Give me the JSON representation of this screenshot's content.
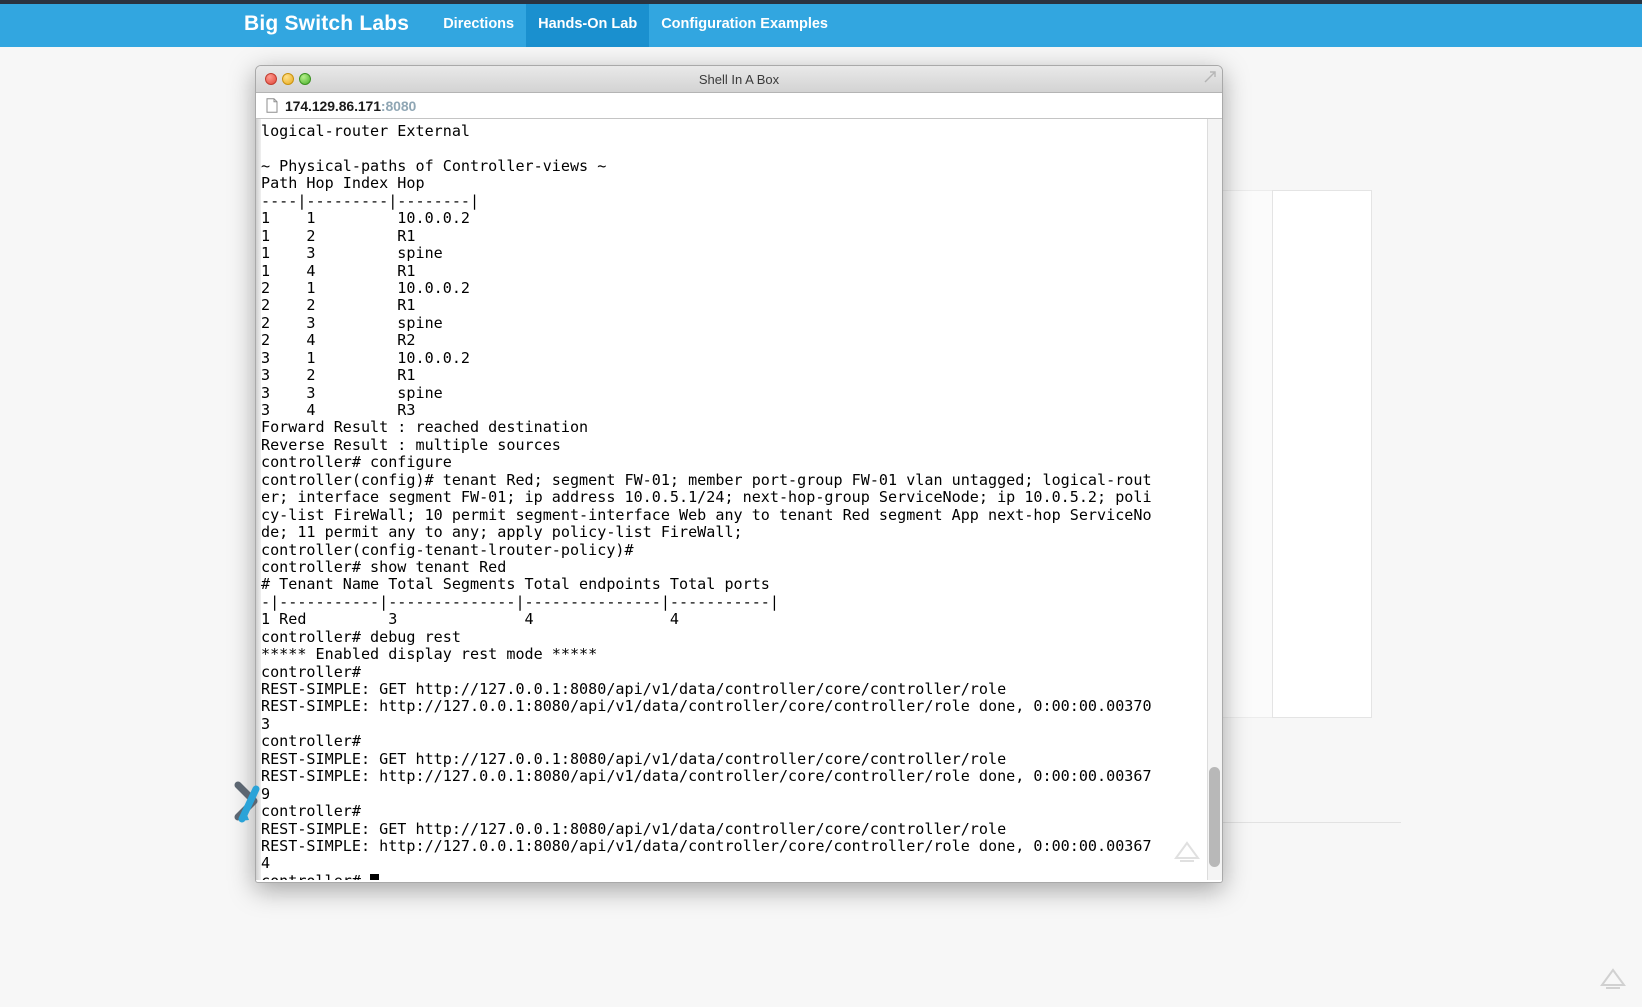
{
  "topnav": {
    "brand": "Big Switch Labs",
    "items": [
      {
        "label": "Directions",
        "active": false
      },
      {
        "label": "Hands-On Lab",
        "active": true
      },
      {
        "label": "Configuration Examples",
        "active": false
      }
    ],
    "background_color": "#32a6e0",
    "active_color": "#1a90cf"
  },
  "window": {
    "title": "Shell In A Box",
    "url_host": "174.129.86.171",
    "url_port": ":8080",
    "traffic_lights": [
      "close-red",
      "minimize-yellow",
      "zoom-green"
    ]
  },
  "terminal": {
    "lines": [
      "logical-router External",
      "",
      "~ Physical-paths of Controller-views ~",
      "Path Hop Index Hop",
      "----|---------|--------|",
      "1    1         10.0.0.2",
      "1    2         R1",
      "1    3         spine",
      "1    4         R1",
      "2    1         10.0.0.2",
      "2    2         R1",
      "2    3         spine",
      "2    4         R2",
      "3    1         10.0.0.2",
      "3    2         R1",
      "3    3         spine",
      "3    4         R3",
      "Forward Result : reached destination",
      "Reverse Result : multiple sources",
      "controller# configure",
      "controller(config)# tenant Red; segment FW-01; member port-group FW-01 vlan untagged; logical-rout",
      "er; interface segment FW-01; ip address 10.0.5.1/24; next-hop-group ServiceNode; ip 10.0.5.2; poli",
      "cy-list FireWall; 10 permit segment-interface Web any to tenant Red segment App next-hop ServiceNo",
      "de; 11 permit any to any; apply policy-list FireWall;",
      "controller(config-tenant-lrouter-policy)#",
      "controller# show tenant Red",
      "# Tenant Name Total Segments Total endpoints Total ports",
      "-|-----------|--------------|---------------|-----------|",
      "1 Red         3              4               4",
      "controller# debug rest",
      "***** Enabled display rest mode *****",
      "controller#",
      "REST-SIMPLE: GET http://127.0.0.1:8080/api/v1/data/controller/core/controller/role",
      "REST-SIMPLE: http://127.0.0.1:8080/api/v1/data/controller/core/controller/role done, 0:00:00.00370",
      "3",
      "controller#",
      "REST-SIMPLE: GET http://127.0.0.1:8080/api/v1/data/controller/core/controller/role",
      "REST-SIMPLE: http://127.0.0.1:8080/api/v1/data/controller/core/controller/role done, 0:00:00.00367",
      "9",
      "controller#",
      "REST-SIMPLE: GET http://127.0.0.1:8080/api/v1/data/controller/core/controller/role",
      "REST-SIMPLE: http://127.0.0.1:8080/api/v1/data/controller/core/controller/role done, 0:00:00.00367",
      "4"
    ],
    "prompt": "controller# ",
    "cursor": "block-cursor",
    "foreground_color": "#000000",
    "background_color": "#ffffff"
  }
}
